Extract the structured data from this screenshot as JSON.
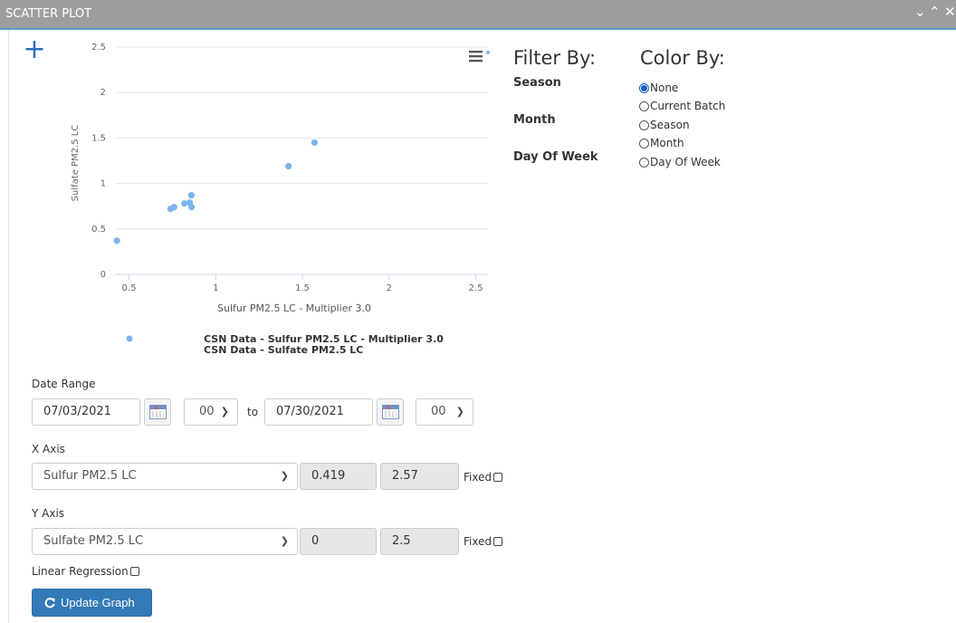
{
  "window": {
    "title": "SCATTER PLOT",
    "controls": [
      "chevron-down",
      "chevron-up",
      "close"
    ]
  },
  "chart_data": {
    "type": "scatter",
    "xlabel": "Sulfur PM2.5 LC - Multiplier 3.0",
    "ylabel": "Sulfate PM2.5 LC",
    "xlim": [
      0.419,
      2.57
    ],
    "ylim": [
      0,
      2.5
    ],
    "x_ticks": [
      "0.5",
      "1",
      "1.5",
      "2",
      "2.5"
    ],
    "y_ticks": [
      "0",
      "0.5",
      "1",
      "1.5",
      "2",
      "2.5"
    ],
    "grid": true,
    "legend": [
      "CSN Data - Sulfur PM2.5 LC - Multiplier 3.0",
      "CSN Data - Sulfate PM2.5 LC"
    ],
    "legend_position": "bottom",
    "point_color": "#7cb5ec",
    "series": [
      {
        "x": [
          0.43,
          0.74,
          0.76,
          0.82,
          0.85,
          0.86,
          0.86,
          1.42,
          1.57
        ],
        "y": [
          0.37,
          0.72,
          0.74,
          0.78,
          0.79,
          0.87,
          0.74,
          1.19,
          1.45
        ]
      }
    ]
  },
  "filter": {
    "heading": "Filter By:",
    "labels": [
      "Season",
      "Month",
      "Day Of Week"
    ]
  },
  "color_by": {
    "heading": "Color By:",
    "options": [
      "None",
      "Current Batch",
      "Season",
      "Month",
      "Day Of Week"
    ],
    "selected": "None"
  },
  "date_range": {
    "label": "Date Range",
    "start_date": "07/03/2021",
    "start_hour": "00",
    "to_label": "to",
    "end_date": "07/30/2021",
    "end_hour": "00"
  },
  "x_axis": {
    "label": "X Axis",
    "variable": "Sulfur PM2.5 LC",
    "min": "0.419",
    "max": "2.57",
    "fixed_label": "Fixed"
  },
  "y_axis": {
    "label": "Y Axis",
    "variable": "Sulfate PM2.5 LC",
    "min": "0",
    "max": "2.5",
    "fixed_label": "Fixed"
  },
  "linear_regression_label": "Linear Regression",
  "update_button_label": "Update Graph",
  "colors": {
    "accent": "#337ab7",
    "title_bar": "#9e9e9e",
    "point": "#7cb5ec"
  }
}
